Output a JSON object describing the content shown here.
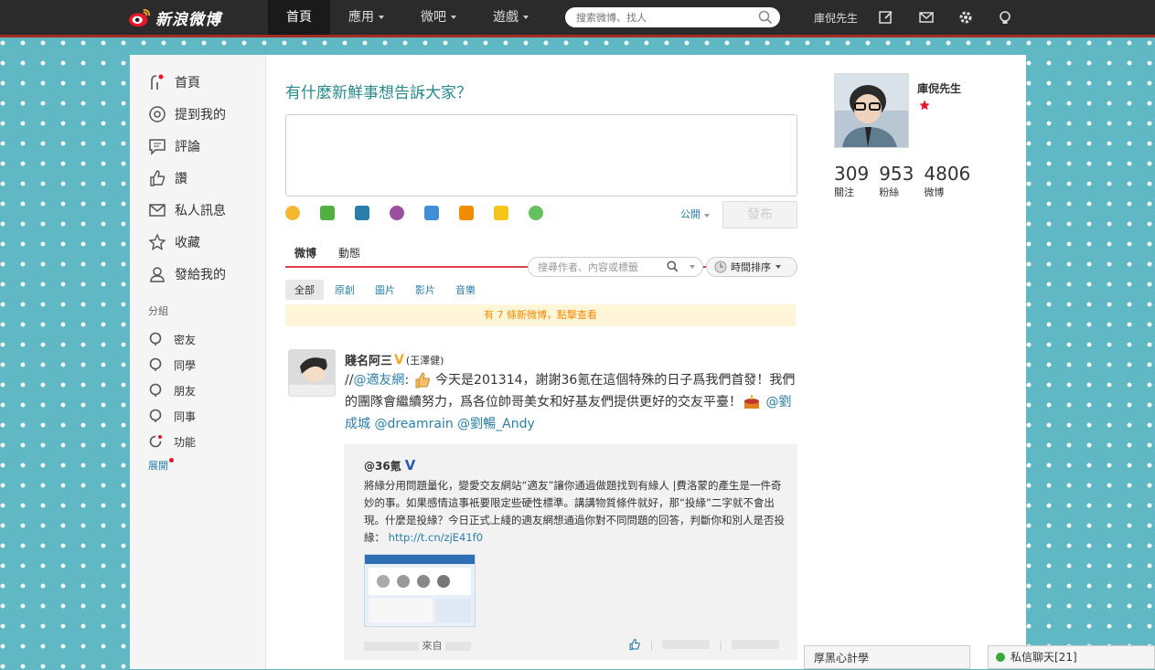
{
  "topbar": {
    "logo_text": "新浪微博",
    "nav": [
      {
        "label": "首頁",
        "active": true
      },
      {
        "label": "應用",
        "dropdown": true
      },
      {
        "label": "微吧",
        "dropdown": true
      },
      {
        "label": "遊戲",
        "dropdown": true
      }
    ],
    "search_placeholder": "搜索微博、找人",
    "username": "庫倪先生",
    "icons": [
      "edit-icon",
      "mail-icon",
      "gear-icon",
      "bulb-icon"
    ]
  },
  "sidebar": {
    "items": [
      {
        "label": "首頁",
        "icon": "home-icon"
      },
      {
        "label": "提到我的",
        "icon": "at-icon"
      },
      {
        "label": "評論",
        "icon": "comment-icon"
      },
      {
        "label": "讚",
        "icon": "thumb-icon"
      },
      {
        "label": "私人訊息",
        "icon": "mail-icon"
      },
      {
        "label": "收藏",
        "icon": "star-icon"
      },
      {
        "label": "發給我的",
        "icon": "person-icon"
      }
    ],
    "group_title": "分組",
    "groups": [
      {
        "label": "密友"
      },
      {
        "label": "同學"
      },
      {
        "label": "朋友"
      },
      {
        "label": "同事"
      },
      {
        "label": "功能"
      }
    ],
    "expand": "展開"
  },
  "composer": {
    "prompt": "有什麼新鮮事想告訴大家？",
    "public_label": "公開",
    "publish_label": "發布",
    "tool_icons": [
      "emoji-icon",
      "image-icon",
      "video-icon",
      "music-icon",
      "topic-icon",
      "vote-icon",
      "note-icon",
      "more-icon"
    ]
  },
  "feed": {
    "tabs": [
      {
        "label": "微博",
        "active": true
      },
      {
        "label": "動態"
      }
    ],
    "filter_placeholder": "搜尋作者、內容或標籤",
    "sort_label": "時間排序",
    "subtabs": [
      {
        "label": "全部",
        "active": true
      },
      {
        "label": "原創"
      },
      {
        "label": "圖片"
      },
      {
        "label": "影片"
      },
      {
        "label": "音樂"
      }
    ],
    "new_notice": "有 7 條新微博，點擊查看",
    "post": {
      "author": "賤名阿三",
      "author_note": "(王澤健)",
      "text_prefix": "//",
      "mention1": "@適友網",
      "text_colon": ": ",
      "text_main": " 今天是201314，謝謝36氪在這個特殊的日子爲我們首發！我們的團隊會繼續努力，爲各位帥哥美女和好基友們提供更好的交友平臺！",
      "mentions_tail": " @劉成城 @dreamrain @劉暢_Andy",
      "quote": {
        "author": "@36氪",
        "text": "將緣分用問題量化，變愛交友網站“適友”讓你通過做題找到有緣人 |費洛蒙的產生是一件奇妙的事。如果感情這事衹要限定些硬性標準。講講物質條件就好，那“投緣”二字就不會出現。什麼是投緣？今日正式上綫的適友網想通過你對不同問題的回答，判斷你和別人是否投緣：",
        "link": "http://t.cn/zjE41f0",
        "source_label": "來自"
      }
    }
  },
  "profile": {
    "name": "庫倪先生",
    "stats": [
      {
        "num": "309",
        "label": "關注"
      },
      {
        "num": "953",
        "label": "粉絲"
      },
      {
        "num": "4806",
        "label": "微博"
      }
    ]
  },
  "floating": {
    "left_label": "厚黑心計學",
    "chat_label": "私信聊天[21]"
  }
}
